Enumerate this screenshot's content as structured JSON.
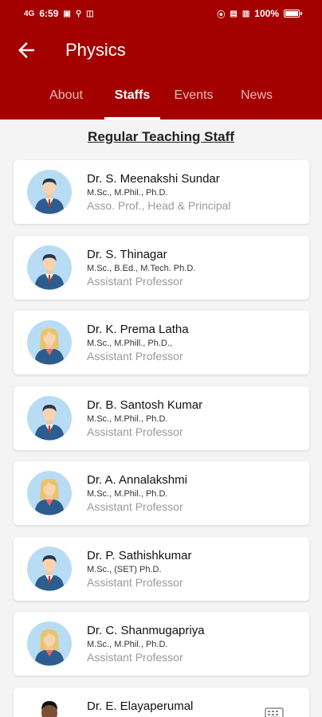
{
  "status": {
    "time": "6:59",
    "left_icons": [
      "4G-signal-icon",
      "message-icon",
      "usb-icon",
      "nfc-icon"
    ],
    "right_icons": [
      "hotspot-icon",
      "wifi-icon",
      "signal-icon"
    ],
    "battery": "100%"
  },
  "header": {
    "title": "Physics",
    "back_icon": "arrow-left-icon"
  },
  "tabs": [
    {
      "label": "About"
    },
    {
      "label": "Staffs"
    },
    {
      "label": "Events"
    },
    {
      "label": "News"
    }
  ],
  "active_tab": "Staffs",
  "section": {
    "title": "Regular Teaching Staff"
  },
  "staff": [
    {
      "name": "Dr. S. Meenakshi Sundar",
      "qualification": "M.Sc., M.Phil., Ph.D.",
      "designation": "Asso. Prof., Head & Principal",
      "avatar": "male-avatar-icon"
    },
    {
      "name": "Dr. S. Thinagar",
      "qualification": "M.Sc., B.Ed., M.Tech. Ph.D.",
      "designation": "Assistant Professor",
      "avatar": "male-avatar-icon"
    },
    {
      "name": "Dr. K. Prema Latha",
      "qualification": "M.Sc., M.Phill., Ph.D.,",
      "designation": "Assistant Professor",
      "avatar": "female-avatar-icon"
    },
    {
      "name": "Dr. B. Santosh  Kumar",
      "qualification": "M.Sc., M.Phil., Ph.D.",
      "designation": "Assistant Professor",
      "avatar": "male-avatar-icon"
    },
    {
      "name": "Dr. A. Annalakshmi",
      "qualification": "M.Sc., M.Phil., Ph.D.",
      "designation": "Assistant Professor",
      "avatar": "female-avatar-icon"
    },
    {
      "name": "Dr. P. Sathishkumar",
      "qualification": "M.Sc., (SET) Ph.D.",
      "designation": "Assistant Professor",
      "avatar": "male-avatar-icon"
    },
    {
      "name": "Dr. C. Shanmugapriya",
      "qualification": "M.Sc., M.Phil., Ph.D.",
      "designation": "Assistant Professor",
      "avatar": "female-avatar-icon"
    },
    {
      "name": "Dr. E. Elayaperumal",
      "qualification": "",
      "designation": "",
      "avatar": "staff-photo"
    }
  ],
  "colors": {
    "primary": "#a40000",
    "avatar_bg": "#b9dcf5",
    "suit": "#2d5d8f"
  }
}
